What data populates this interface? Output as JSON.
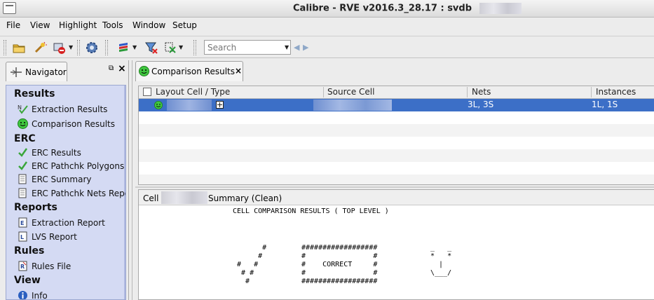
{
  "window": {
    "title": "Calibre - RVE v2016.3_28.17 : svdb"
  },
  "menu": [
    "File",
    "View",
    "Highlight",
    "Tools",
    "Window",
    "Setup"
  ],
  "toolbar": {
    "search_placeholder": "Search"
  },
  "navigator": {
    "tab_label": "Navigator",
    "sections": [
      {
        "title": "Results",
        "items": [
          {
            "label": "Extraction Results",
            "icon": "extraction-check-icon"
          },
          {
            "label": "Comparison Results",
            "icon": "smiley-icon"
          }
        ]
      },
      {
        "title": "ERC",
        "items": [
          {
            "label": "ERC Results",
            "icon": "green-check-icon"
          },
          {
            "label": "ERC Pathchk Polygons",
            "icon": "green-check-icon"
          },
          {
            "label": "ERC Summary",
            "icon": "document-icon"
          },
          {
            "label": "ERC Pathchk Nets Repo",
            "icon": "document-icon"
          }
        ]
      },
      {
        "title": "Reports",
        "items": [
          {
            "label": "Extraction Report",
            "icon": "report-e-icon"
          },
          {
            "label": "LVS Report",
            "icon": "report-l-icon"
          }
        ]
      },
      {
        "title": "Rules",
        "items": [
          {
            "label": "Rules File",
            "icon": "rules-file-icon"
          }
        ]
      },
      {
        "title": "View",
        "items": [
          {
            "label": "Info",
            "icon": "info-icon"
          }
        ]
      }
    ]
  },
  "results_tab": {
    "label": "Comparison Results"
  },
  "table": {
    "columns": [
      "Layout Cell / Type",
      "Source Cell",
      "Nets",
      "Instances"
    ],
    "rows": [
      {
        "nets": "3L, 3S",
        "instances": "1L, 1S"
      }
    ]
  },
  "summary": {
    "label_prefix": "Cell",
    "label_suffix": "Summary (Clean)",
    "heading": "CELL COMPARISON RESULTS ( TOP LEVEL )",
    "art": {
      "check": "       #\n      #\n #   #\n  # #\n   #",
      "box": "##################\n#                #\n#    CORRECT     #\n#                #\n##################",
      "face": " _   _\n *   *\n   |\n \\___/"
    }
  },
  "colors": {
    "selection": "#3c6fc7",
    "navigator_bg": "#d4daf3",
    "check_green": "#3aa63a"
  }
}
